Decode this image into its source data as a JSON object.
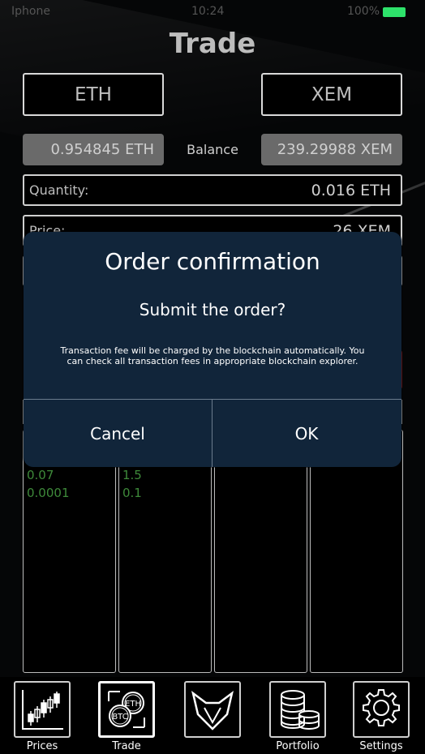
{
  "status_bar": {
    "carrier": "Iphone",
    "time": "10:24",
    "battery_pct": "100%"
  },
  "header": {
    "title": "Trade"
  },
  "pair": {
    "base": "ETH",
    "quote": "XEM"
  },
  "balance": {
    "label": "Balance",
    "base_amount": "0.954845 ETH",
    "quote_amount": "239.29988 XEM"
  },
  "form": {
    "quantity_label": "Quantity:",
    "quantity_value": "0.016",
    "quantity_unit": "ETH",
    "price_label": "Price:",
    "price_value": "26 XEM"
  },
  "order_book": {
    "col1_values": [
      "0.07",
      "0.0001"
    ],
    "col2_values": [
      "1.5",
      "0.1"
    ]
  },
  "modal": {
    "title": "Order confirmation",
    "subtitle": "Submit the order?",
    "body": "Transaction fee will be charged by the blockchain automatically. You can check all transaction fees in appropriate blockchain explorer.",
    "cancel_label": "Cancel",
    "ok_label": "OK"
  },
  "nav": {
    "items": [
      {
        "label": "Prices",
        "icon": "candlestick-chart-icon"
      },
      {
        "label": "Trade",
        "icon": "coin-exchange-icon"
      },
      {
        "label": "",
        "icon": "fox-logo-icon"
      },
      {
        "label": "Portfolio",
        "icon": "coin-stack-icon"
      },
      {
        "label": "Settings",
        "icon": "gear-icon"
      }
    ]
  },
  "colors": {
    "modal_bg": "#11253a",
    "positive": "#3e8a3a",
    "battery": "#2ee26b"
  }
}
